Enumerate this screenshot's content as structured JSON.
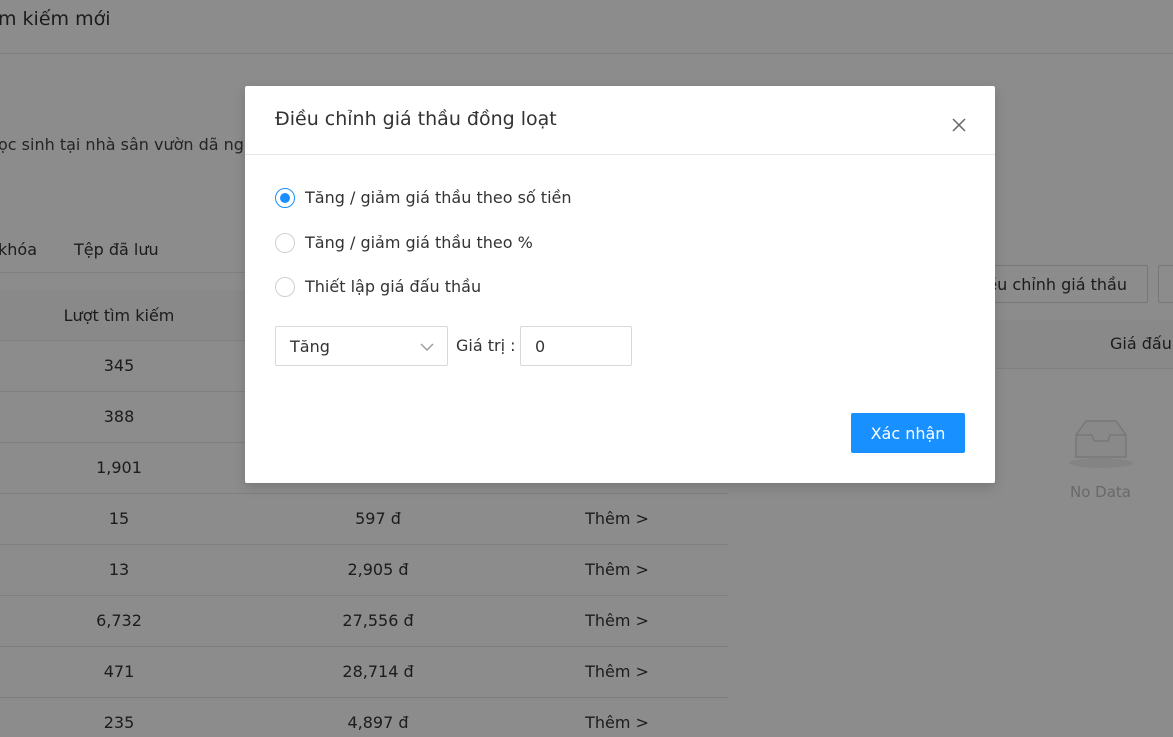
{
  "page": {
    "title": "m kiếm mới",
    "description": "ọc sinh tại nhà sân vườn dã ngo",
    "tabs": [
      {
        "label": "khóa"
      },
      {
        "label": "Tệp đã lưu"
      }
    ],
    "table": {
      "headers": {
        "searches": "Lượt tìm kiếm"
      },
      "rows": [
        {
          "searches": "345",
          "price": "",
          "action": ""
        },
        {
          "searches": "388",
          "price": "",
          "action": ""
        },
        {
          "searches": "1,901",
          "price": "",
          "action": ""
        },
        {
          "searches": "15",
          "price": "597 đ",
          "action": "Thêm >"
        },
        {
          "searches": "13",
          "price": "2,905 đ",
          "action": "Thêm >"
        },
        {
          "searches": "6,732",
          "price": "27,556 đ",
          "action": "Thêm >"
        },
        {
          "searches": "471",
          "price": "28,714 đ",
          "action": "Thêm >"
        },
        {
          "searches": "235",
          "price": "4,897 đ",
          "action": "Thêm >"
        }
      ]
    },
    "right_panel": {
      "adjust_button": "ều chỉnh giá thầu",
      "column_header": "Giá đấu",
      "empty_text": "No Data"
    }
  },
  "modal": {
    "title": "Điều chỉnh giá thầu đồng loạt",
    "close_icon": "close-icon",
    "options": [
      {
        "label": "Tăng / giảm giá thầu theo số tiền",
        "checked": true
      },
      {
        "label": "Tăng / giảm giá thầu theo %",
        "checked": false
      },
      {
        "label": "Thiết lập giá đấu thầu",
        "checked": false
      }
    ],
    "direction_select": {
      "value": "Tăng"
    },
    "value_label": "Giá trị :",
    "value_input": {
      "value": "0"
    },
    "confirm_label": "Xác nhận"
  },
  "colors": {
    "primary": "#1890ff",
    "mask": "rgba(0,0,0,0.45)"
  }
}
